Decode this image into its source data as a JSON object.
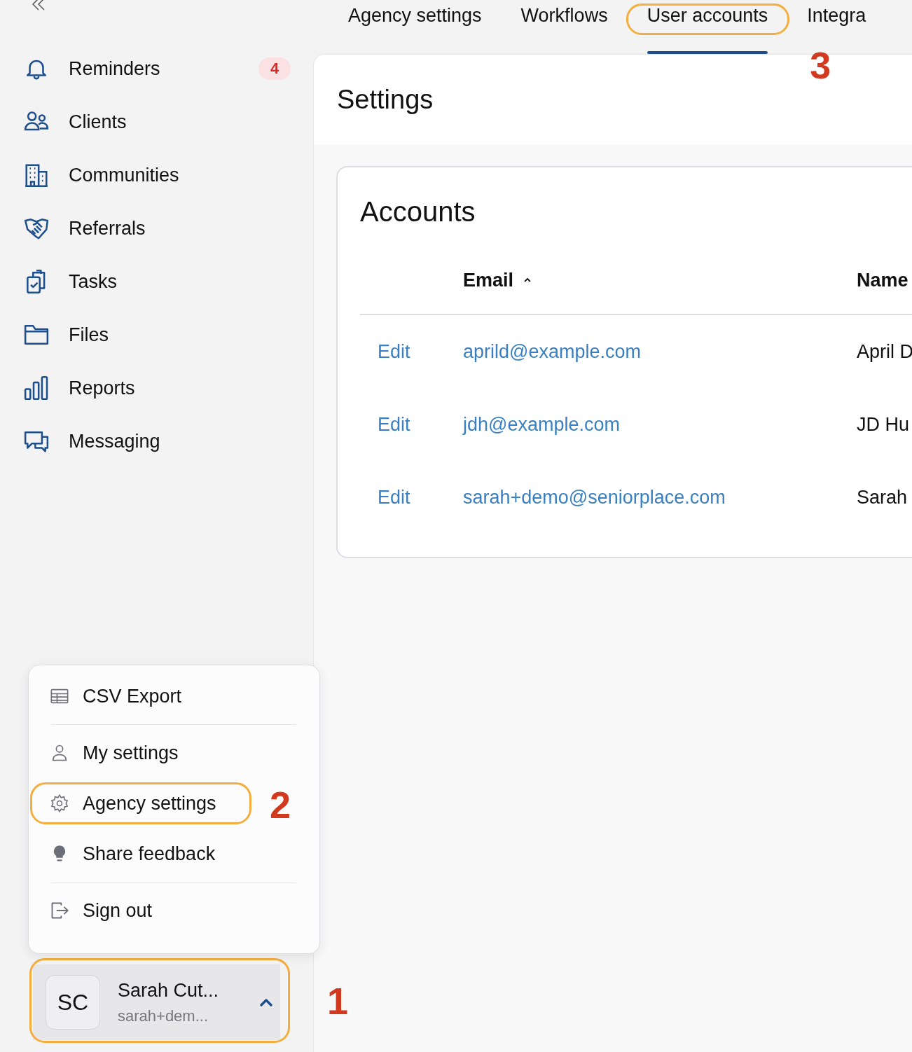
{
  "sidebar": {
    "items": [
      {
        "label": "Reminders",
        "badge": "4"
      },
      {
        "label": "Clients"
      },
      {
        "label": "Communities"
      },
      {
        "label": "Referrals"
      },
      {
        "label": "Tasks"
      },
      {
        "label": "Files"
      },
      {
        "label": "Reports"
      },
      {
        "label": "Messaging"
      }
    ],
    "user": {
      "initials": "SC",
      "name": "Sarah Cut...",
      "email": "sarah+dem...",
      "expanded": true,
      "callout": "1"
    }
  },
  "menu": {
    "groups": [
      [
        {
          "label": "CSV Export"
        }
      ],
      [
        {
          "label": "My settings"
        },
        {
          "label": "Agency settings",
          "callout": "2"
        },
        {
          "label": "Share feedback"
        }
      ],
      [
        {
          "label": "Sign out"
        }
      ]
    ]
  },
  "tabs": [
    {
      "label": "Agency settings",
      "selected": false
    },
    {
      "label": "Workflows",
      "selected": false
    },
    {
      "label": "User accounts",
      "selected": true,
      "callout": "3"
    },
    {
      "label": "Integra",
      "selected": false
    }
  ],
  "page": {
    "title": "Settings"
  },
  "accounts": {
    "title": "Accounts",
    "columns": [
      {
        "label": "Email",
        "sorted_ascending": true
      },
      {
        "label": "Name"
      }
    ],
    "rows": [
      {
        "action": "Edit",
        "email": "aprild@example.com",
        "name": "April D"
      },
      {
        "action": "Edit",
        "email": "jdh@example.com",
        "name": "JD Hu"
      },
      {
        "action": "Edit",
        "email": "sarah+demo@seniorplace.com",
        "name": "Sarah"
      }
    ]
  }
}
